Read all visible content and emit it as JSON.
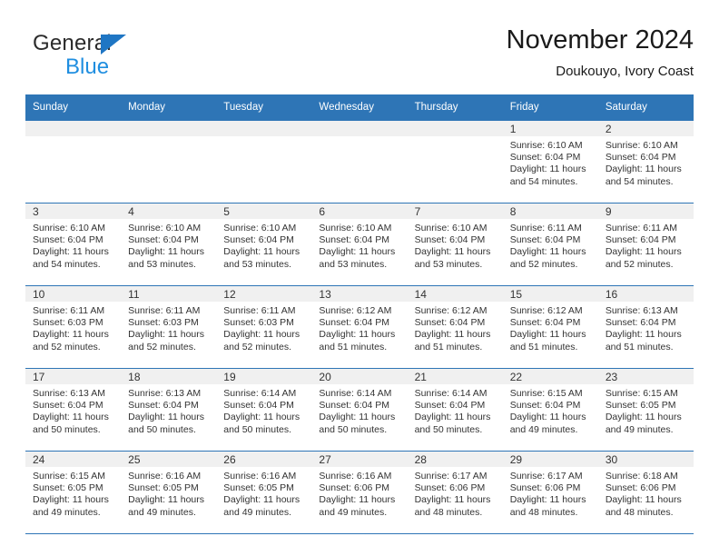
{
  "brand": {
    "name_top": "General",
    "name_bottom": "Blue",
    "triangle_color": "#1f76c4",
    "blue_color": "#1f8ee0"
  },
  "header": {
    "title": "November 2024",
    "location": "Doukouyo, Ivory Coast"
  },
  "theme": {
    "header_bg": "#2e75b6",
    "header_text": "#ffffff",
    "daynum_band_bg": "#f0f0f0",
    "grid_line": "#2e75b6",
    "cell_text": "#333333"
  },
  "weekday_headers": [
    "Sunday",
    "Monday",
    "Tuesday",
    "Wednesday",
    "Thursday",
    "Friday",
    "Saturday"
  ],
  "weeks": [
    [
      {
        "day": "",
        "empty": true
      },
      {
        "day": "",
        "empty": true
      },
      {
        "day": "",
        "empty": true
      },
      {
        "day": "",
        "empty": true
      },
      {
        "day": "",
        "empty": true
      },
      {
        "day": "1",
        "sunrise": "Sunrise: 6:10 AM",
        "sunset": "Sunset: 6:04 PM",
        "daylight": "Daylight: 11 hours and 54 minutes."
      },
      {
        "day": "2",
        "sunrise": "Sunrise: 6:10 AM",
        "sunset": "Sunset: 6:04 PM",
        "daylight": "Daylight: 11 hours and 54 minutes."
      }
    ],
    [
      {
        "day": "3",
        "sunrise": "Sunrise: 6:10 AM",
        "sunset": "Sunset: 6:04 PM",
        "daylight": "Daylight: 11 hours and 54 minutes."
      },
      {
        "day": "4",
        "sunrise": "Sunrise: 6:10 AM",
        "sunset": "Sunset: 6:04 PM",
        "daylight": "Daylight: 11 hours and 53 minutes."
      },
      {
        "day": "5",
        "sunrise": "Sunrise: 6:10 AM",
        "sunset": "Sunset: 6:04 PM",
        "daylight": "Daylight: 11 hours and 53 minutes."
      },
      {
        "day": "6",
        "sunrise": "Sunrise: 6:10 AM",
        "sunset": "Sunset: 6:04 PM",
        "daylight": "Daylight: 11 hours and 53 minutes."
      },
      {
        "day": "7",
        "sunrise": "Sunrise: 6:10 AM",
        "sunset": "Sunset: 6:04 PM",
        "daylight": "Daylight: 11 hours and 53 minutes."
      },
      {
        "day": "8",
        "sunrise": "Sunrise: 6:11 AM",
        "sunset": "Sunset: 6:04 PM",
        "daylight": "Daylight: 11 hours and 52 minutes."
      },
      {
        "day": "9",
        "sunrise": "Sunrise: 6:11 AM",
        "sunset": "Sunset: 6:04 PM",
        "daylight": "Daylight: 11 hours and 52 minutes."
      }
    ],
    [
      {
        "day": "10",
        "sunrise": "Sunrise: 6:11 AM",
        "sunset": "Sunset: 6:03 PM",
        "daylight": "Daylight: 11 hours and 52 minutes."
      },
      {
        "day": "11",
        "sunrise": "Sunrise: 6:11 AM",
        "sunset": "Sunset: 6:03 PM",
        "daylight": "Daylight: 11 hours and 52 minutes."
      },
      {
        "day": "12",
        "sunrise": "Sunrise: 6:11 AM",
        "sunset": "Sunset: 6:03 PM",
        "daylight": "Daylight: 11 hours and 52 minutes."
      },
      {
        "day": "13",
        "sunrise": "Sunrise: 6:12 AM",
        "sunset": "Sunset: 6:04 PM",
        "daylight": "Daylight: 11 hours and 51 minutes."
      },
      {
        "day": "14",
        "sunrise": "Sunrise: 6:12 AM",
        "sunset": "Sunset: 6:04 PM",
        "daylight": "Daylight: 11 hours and 51 minutes."
      },
      {
        "day": "15",
        "sunrise": "Sunrise: 6:12 AM",
        "sunset": "Sunset: 6:04 PM",
        "daylight": "Daylight: 11 hours and 51 minutes."
      },
      {
        "day": "16",
        "sunrise": "Sunrise: 6:13 AM",
        "sunset": "Sunset: 6:04 PM",
        "daylight": "Daylight: 11 hours and 51 minutes."
      }
    ],
    [
      {
        "day": "17",
        "sunrise": "Sunrise: 6:13 AM",
        "sunset": "Sunset: 6:04 PM",
        "daylight": "Daylight: 11 hours and 50 minutes."
      },
      {
        "day": "18",
        "sunrise": "Sunrise: 6:13 AM",
        "sunset": "Sunset: 6:04 PM",
        "daylight": "Daylight: 11 hours and 50 minutes."
      },
      {
        "day": "19",
        "sunrise": "Sunrise: 6:14 AM",
        "sunset": "Sunset: 6:04 PM",
        "daylight": "Daylight: 11 hours and 50 minutes."
      },
      {
        "day": "20",
        "sunrise": "Sunrise: 6:14 AM",
        "sunset": "Sunset: 6:04 PM",
        "daylight": "Daylight: 11 hours and 50 minutes."
      },
      {
        "day": "21",
        "sunrise": "Sunrise: 6:14 AM",
        "sunset": "Sunset: 6:04 PM",
        "daylight": "Daylight: 11 hours and 50 minutes."
      },
      {
        "day": "22",
        "sunrise": "Sunrise: 6:15 AM",
        "sunset": "Sunset: 6:04 PM",
        "daylight": "Daylight: 11 hours and 49 minutes."
      },
      {
        "day": "23",
        "sunrise": "Sunrise: 6:15 AM",
        "sunset": "Sunset: 6:05 PM",
        "daylight": "Daylight: 11 hours and 49 minutes."
      }
    ],
    [
      {
        "day": "24",
        "sunrise": "Sunrise: 6:15 AM",
        "sunset": "Sunset: 6:05 PM",
        "daylight": "Daylight: 11 hours and 49 minutes."
      },
      {
        "day": "25",
        "sunrise": "Sunrise: 6:16 AM",
        "sunset": "Sunset: 6:05 PM",
        "daylight": "Daylight: 11 hours and 49 minutes."
      },
      {
        "day": "26",
        "sunrise": "Sunrise: 6:16 AM",
        "sunset": "Sunset: 6:05 PM",
        "daylight": "Daylight: 11 hours and 49 minutes."
      },
      {
        "day": "27",
        "sunrise": "Sunrise: 6:16 AM",
        "sunset": "Sunset: 6:06 PM",
        "daylight": "Daylight: 11 hours and 49 minutes."
      },
      {
        "day": "28",
        "sunrise": "Sunrise: 6:17 AM",
        "sunset": "Sunset: 6:06 PM",
        "daylight": "Daylight: 11 hours and 48 minutes."
      },
      {
        "day": "29",
        "sunrise": "Sunrise: 6:17 AM",
        "sunset": "Sunset: 6:06 PM",
        "daylight": "Daylight: 11 hours and 48 minutes."
      },
      {
        "day": "30",
        "sunrise": "Sunrise: 6:18 AM",
        "sunset": "Sunset: 6:06 PM",
        "daylight": "Daylight: 11 hours and 48 minutes."
      }
    ]
  ]
}
